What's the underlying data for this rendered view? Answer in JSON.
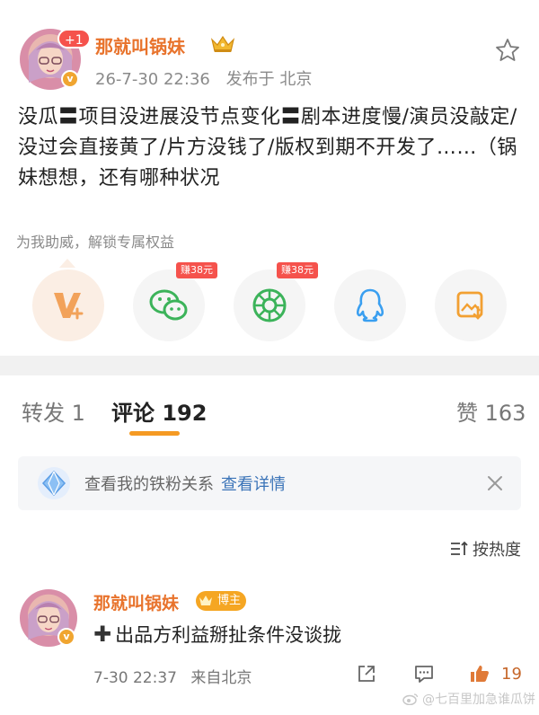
{
  "post": {
    "follow_badge": "+1",
    "author": "那就叫锅妹",
    "time": "26-7-30 22:36",
    "location": "发布于 北京",
    "text": "没瓜〓项目没进展没节点变化〓剧本进度慢/演员没敲定/没过会直接黄了/片方没钱了/版权到期不开发了……（锅妹想想，还有哪种状况",
    "cheer_text": "为我助威，解锁专属权益"
  },
  "share": {
    "items": [
      {
        "name": "vip-icon",
        "reward": ""
      },
      {
        "name": "wechat-icon",
        "reward": "赚38元"
      },
      {
        "name": "moments-icon",
        "reward": "赚38元"
      },
      {
        "name": "qq-icon",
        "reward": ""
      },
      {
        "name": "save-image-icon",
        "reward": ""
      }
    ]
  },
  "tabs": {
    "repost": "转发 1",
    "comments": "评论 192",
    "likes": "赞 163"
  },
  "fan_banner": {
    "text": "查看我的铁粉关系",
    "link": "查看详情"
  },
  "sort": {
    "label": "按热度"
  },
  "comment": {
    "author": "那就叫锅妹",
    "badge": "博主",
    "text": "出品方利益掰扯条件没谈拢",
    "time": "7-30 22:37",
    "location": "来自北京",
    "likes": "19"
  },
  "watermark": "@七百里加急谁瓜饼",
  "colors": {
    "author_orange": "#e8732c",
    "accent_underline": "#f59a23",
    "badge_red": "#f5524c",
    "link_blue": "#3b74b8"
  }
}
